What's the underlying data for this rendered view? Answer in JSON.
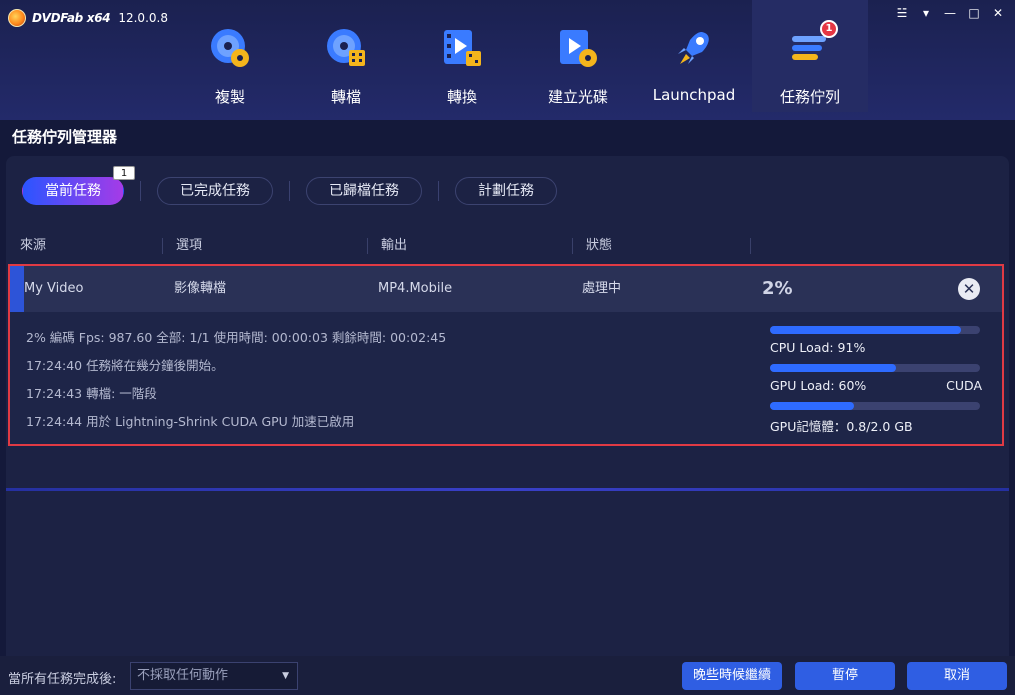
{
  "app": {
    "logo_text": "DVDFab x64",
    "version": "12.0.0.8"
  },
  "window_controls": [
    "☱",
    "▾",
    "—",
    "□",
    "✕"
  ],
  "nav": {
    "items": [
      {
        "label": "複製",
        "icon": "copy-disc-icon"
      },
      {
        "label": "轉檔",
        "icon": "rip-disc-icon"
      },
      {
        "label": "轉換",
        "icon": "convert-film-icon"
      },
      {
        "label": "建立光碟",
        "icon": "creator-disc-icon"
      },
      {
        "label": "Launchpad",
        "icon": "rocket-icon"
      },
      {
        "label": "任務佇列",
        "icon": "task-queue-icon",
        "badge": "1"
      }
    ]
  },
  "page_title": "任務佇列管理器",
  "tabs": [
    {
      "label": "當前任務",
      "count": "1"
    },
    {
      "label": "已完成任務"
    },
    {
      "label": "已歸檔任務"
    },
    {
      "label": "計劃任務"
    }
  ],
  "columns": [
    "來源",
    "選項",
    "輸出",
    "狀態"
  ],
  "task": {
    "source": "My Video",
    "option": "影像轉檔",
    "output": "MP4.Mobile",
    "status": "處理中",
    "progress_text": "2%",
    "progress": 0.02,
    "log": [
      "2%  編碼 Fps: 987.60  全部:  1/1  使用時間:  00:00:03  剩餘時間:  00:02:45",
      "17:24:40  任務將在幾分鐘後開始。",
      "17:24:43  轉檔: 一階段",
      "17:24:44  用於 Lightning-Shrink CUDA GPU 加速已啟用"
    ],
    "meters": [
      {
        "label": "CPU Load: 91%",
        "value": 0.91
      },
      {
        "label": "GPU Load: 60%",
        "value": 0.6,
        "extra": "CUDA"
      },
      {
        "label": "GPU記憶體：0.8/2.0 GB",
        "value": 0.4
      }
    ]
  },
  "footer": {
    "label": "當所有任務完成後:",
    "select_value": "不採取任何動作",
    "buttons": [
      "晚些時候繼續",
      "暫停",
      "取消"
    ]
  },
  "colors": {
    "accent": "#2f5ee3",
    "tab_gradient_start": "#2b55ff",
    "tab_gradient_end": "#a53be7",
    "highlight_border": "#e03a44",
    "badge": "#e53744"
  }
}
